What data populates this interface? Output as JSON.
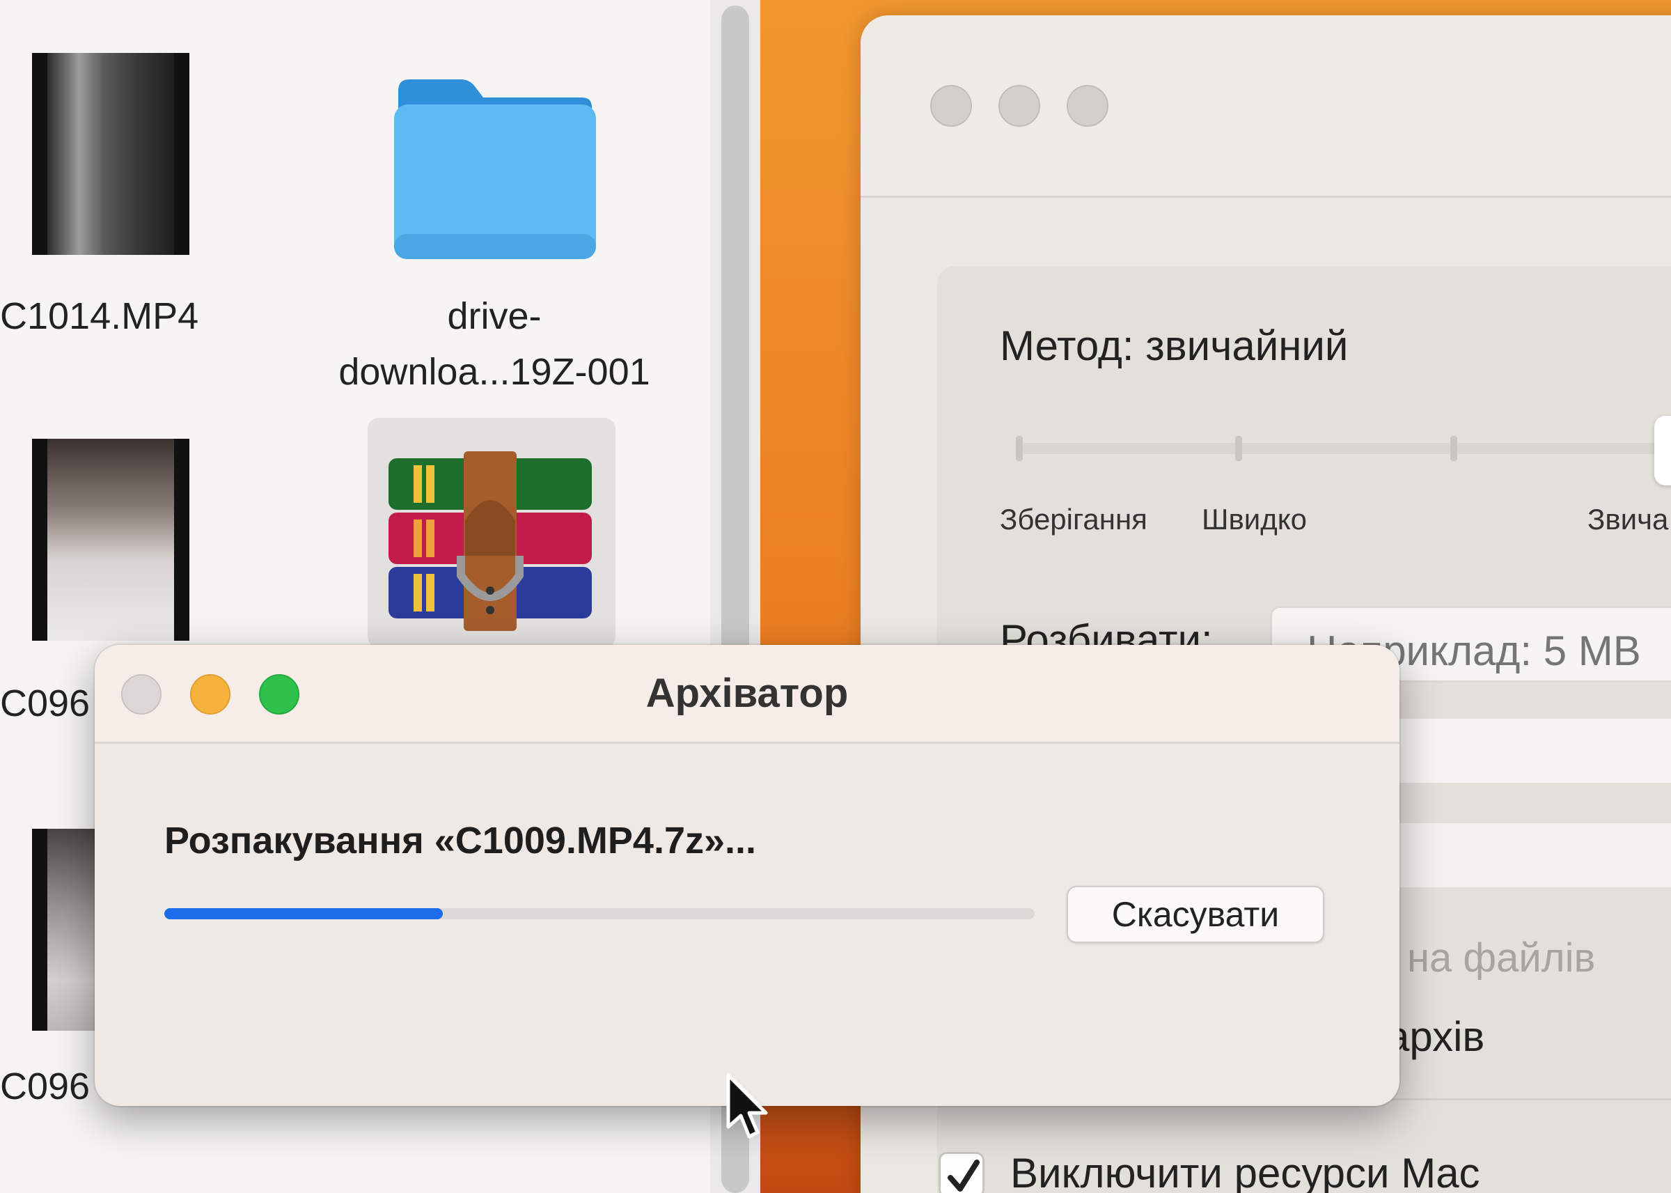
{
  "finder": {
    "files": [
      {
        "label": "C1014.MP4",
        "type": "video"
      },
      {
        "label_line1": "drive-",
        "label_line2": "downloa...19Z-001",
        "type": "folder"
      },
      {
        "label": "C096",
        "type": "video"
      },
      {
        "label": "",
        "type": "archive-app"
      },
      {
        "label": "C096",
        "type": "video"
      }
    ]
  },
  "background_window": {
    "method_label": "Метод: звичайний",
    "slider_labels": [
      "Зберігання",
      "Швидко",
      "Звича"
    ],
    "split_label": "Розбивати:",
    "split_placeholder": "Наприклад: 5 MB",
    "option_1": "на файлів",
    "option_2": "архів",
    "exclude_label": "Виключити ресурси Mac",
    "exclude_checked": true
  },
  "dialog": {
    "title": "Архіватор",
    "status": "Розпакування «C1009.MP4.7z»...",
    "progress": 0.32,
    "cancel_label": "Скасувати"
  },
  "colors": {
    "accent": "#1c6ee8",
    "close": "#dcd7d4",
    "minimize": "#f6b33c",
    "zoom": "#2fc04a",
    "desktop": "#ea7d21"
  }
}
